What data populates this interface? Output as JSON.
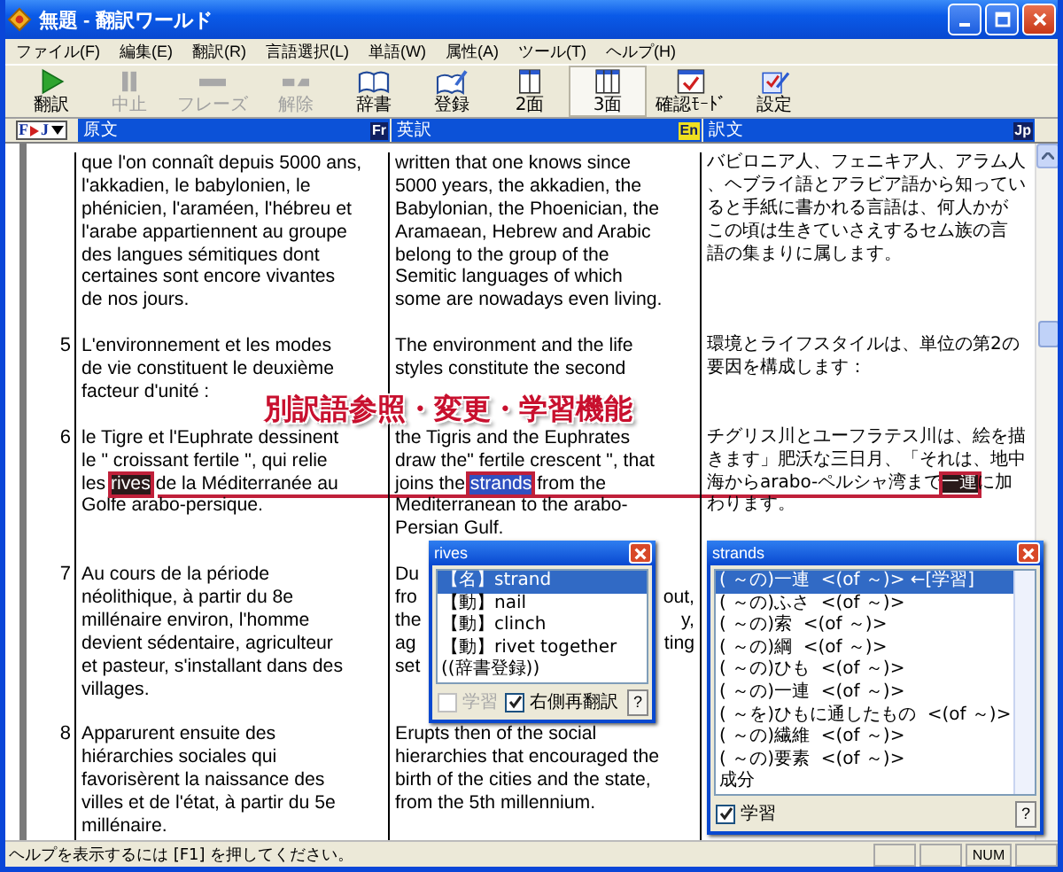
{
  "window": {
    "title": "無題 - 翻訳ワールド"
  },
  "menu": [
    "ファイル(F)",
    "編集(E)",
    "翻訳(R)",
    "言語選択(L)",
    "単語(W)",
    "属性(A)",
    "ツール(T)",
    "ヘルプ(H)"
  ],
  "toolbar": [
    {
      "label": "翻訳",
      "disabled": false,
      "selected": false
    },
    {
      "label": "中止",
      "disabled": true,
      "selected": false
    },
    {
      "label": "フレーズ",
      "disabled": true,
      "selected": false
    },
    {
      "label": "解除",
      "disabled": true,
      "selected": false
    },
    {
      "label": "辞書",
      "disabled": false,
      "selected": false
    },
    {
      "label": "登録",
      "disabled": false,
      "selected": false
    },
    {
      "label": "2面",
      "disabled": false,
      "selected": false
    },
    {
      "label": "3面",
      "disabled": false,
      "selected": true
    },
    {
      "label": "確認ﾓｰﾄﾞ",
      "disabled": false,
      "selected": false
    },
    {
      "label": "設定",
      "disabled": false,
      "selected": false
    }
  ],
  "language_selector": {
    "from": "F",
    "to": "J"
  },
  "columns": [
    {
      "title": "原文",
      "badge": "Fr"
    },
    {
      "title": "英訳",
      "badge": "En"
    },
    {
      "title": "訳文",
      "badge": "Jp"
    }
  ],
  "segments": [
    {
      "source": [
        "que l'on connaît depuis 5000 ans,",
        " l'akkadien, le babylonien, le",
        "phénicien, l'araméen, l'hébreu et",
        "l'arabe appartiennent au groupe",
        "des langues sémitiques dont",
        "certaines sont encore vivantes",
        "de nos jours."
      ],
      "english": [
        "written that one knows since",
        "5000 years, the akkadien, the",
        "Babylonian, the Phoenician, the",
        "Aramaean, Hebrew and Arabic",
        "belong to the group of the",
        "Semitic languages of which",
        "some are nowadays even living."
      ],
      "japanese": [
        "バビロニア人、フェニキア人、アラム人",
        "、ヘブライ語とアラビア語から知ってい",
        "ると手紙に書かれる言語は、何人かが",
        "この頃は生きていさえするセム族の言",
        "語の集まりに属します。"
      ]
    },
    {
      "number": "5",
      "source": [
        "L'environnement et les modes",
        "de vie constituent le deuxième",
        "facteur d'unité :"
      ],
      "english": [
        "The environment and the life",
        "styles constitute the second"
      ],
      "japanese": [
        "環境とライフスタイルは、単位の第2の",
        "要因を構成します："
      ]
    },
    {
      "number": "6",
      "source": [
        "le Tigre et l'Euphrate dessinent",
        "le \" croissant fertile \", qui relie",
        {
          "segments": [
            {
              "text": "les ",
              "kind": "plain"
            },
            {
              "text": "rives",
              "kind": "dark"
            },
            {
              "text": " de la Méditerranée au",
              "kind": "plain"
            }
          ]
        },
        "Golfe arabo-persique."
      ],
      "english": [
        "the Tigris and the Euphrates",
        "draw the\" fertile crescent \", that",
        {
          "segments": [
            {
              "text": "joins the ",
              "kind": "plain"
            },
            {
              "text": "strands",
              "kind": "blue"
            },
            {
              "text": " from the",
              "kind": "plain"
            }
          ]
        },
        "Mediterranean to the arabo-",
        "Persian Gulf."
      ],
      "japanese": [
        "チグリス川とユーフラテス川は、絵を描",
        "きます」肥沃な三日月、「それは、地中",
        {
          "segments": [
            {
              "text": "海からarabo-ペルシャ湾まで",
              "kind": "plain"
            },
            {
              "text": "一連",
              "kind": "dark"
            },
            {
              "text": "に加",
              "kind": "plain"
            }
          ]
        },
        "わります。"
      ]
    },
    {
      "number": "7",
      "source": [
        "Au cours de la période",
        "néolithique, à partir du 8e",
        "millénaire environ, l'homme",
        "devient sédentaire, agriculteur",
        "et pasteur, s'installant dans des",
        "villages."
      ],
      "english": [
        {
          "text": "Du"
        },
        {
          "text": "fro",
          "tail": "out,"
        },
        {
          "text": "the",
          "tail": "y,"
        },
        {
          "text": "ag",
          "tail": "ting"
        },
        {
          "text": "set"
        }
      ]
    },
    {
      "number": "8",
      "source": [
        "Apparurent ensuite des",
        "hiérarchies sociales qui",
        "favorisèrent la naissance des",
        "villes et de l'état, à partir du 5e",
        "millénaire."
      ],
      "english": [
        "Erupts then of the social",
        "hierarchies that encouraged the",
        "birth of the cities and the state,",
        "from the 5th millennium."
      ]
    }
  ],
  "banner": "別訳語参照・変更・学習機能",
  "popups": [
    {
      "title": "rives",
      "items": [
        {
          "text": "【名】strand",
          "selected": true
        },
        {
          "text": "【動】nail",
          "selected": false
        },
        {
          "text": "【動】clinch",
          "selected": false
        },
        {
          "text": "【動】rivet together",
          "selected": false
        },
        {
          "text": "((辞書登録))",
          "selected": false
        }
      ],
      "options": [
        {
          "label": "学習",
          "checked": false,
          "disabled": true
        },
        {
          "label": "右側再翻訳",
          "checked": true,
          "disabled": false
        }
      ],
      "help": "?"
    },
    {
      "title": "strands",
      "items": [
        {
          "text": "( ～の)一連  <(of ～)> ←[学習]",
          "selected": true
        },
        {
          "text": "( ～の)ふさ  <(of ～)>",
          "selected": false
        },
        {
          "text": "( ～の)索  <(of ～)>",
          "selected": false
        },
        {
          "text": "( ～の)綱  <(of ～)>",
          "selected": false
        },
        {
          "text": "( ～の)ひも  <(of ～)>",
          "selected": false
        },
        {
          "text": "( ～の)一連  <(of ～)>",
          "selected": false
        },
        {
          "text": "( ～を)ひもに通したもの  <(of ～)>",
          "selected": false
        },
        {
          "text": "( ～の)繊維  <(of ～)>",
          "selected": false
        },
        {
          "text": "( ～の)要素  <(of ～)>",
          "selected": false
        },
        {
          "text": "成分",
          "selected": false
        }
      ],
      "options": [
        {
          "label": "学習",
          "checked": true,
          "disabled": false
        }
      ],
      "help": "?"
    }
  ],
  "status_bar": {
    "text": "ヘルプを表示するには [F1] を押してください。",
    "indicator": "NUM"
  }
}
